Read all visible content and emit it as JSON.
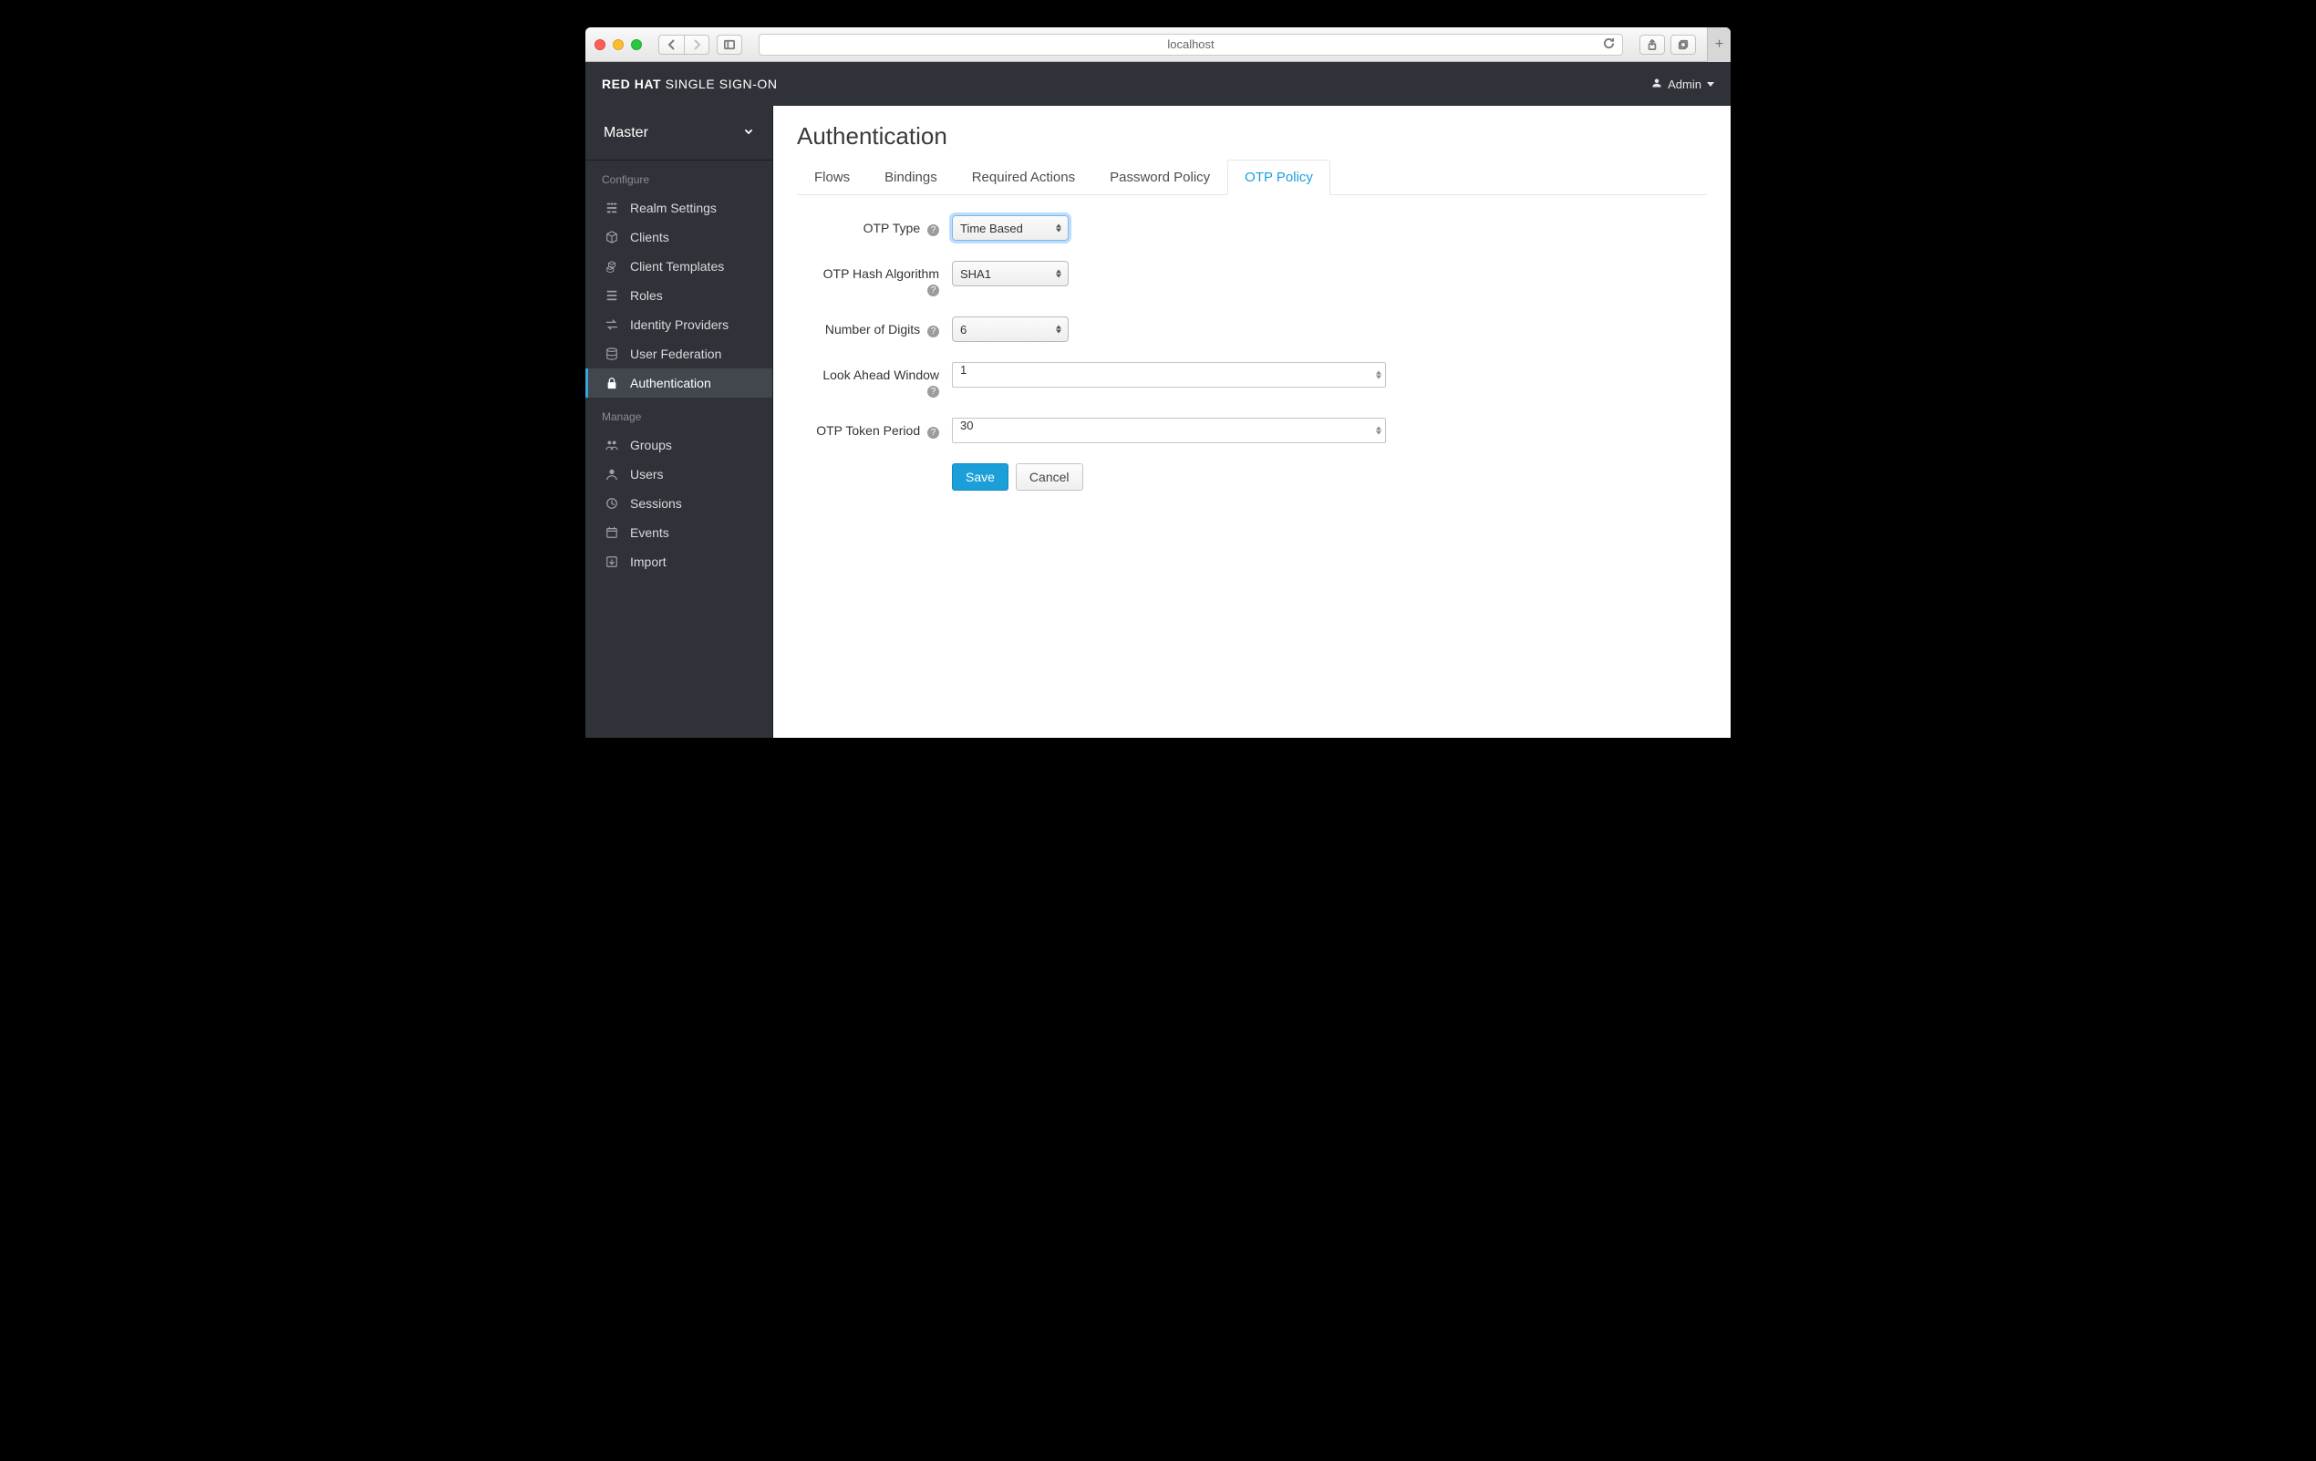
{
  "browser": {
    "url": "localhost"
  },
  "header": {
    "brand_bold": "RED HAT",
    "brand_light": "SINGLE SIGN-ON",
    "user_label": "Admin"
  },
  "realm": {
    "name": "Master"
  },
  "sidebar": {
    "section_configure": "Configure",
    "section_manage": "Manage",
    "configure_items": [
      {
        "label": "Realm Settings",
        "icon": "sliders"
      },
      {
        "label": "Clients",
        "icon": "cube"
      },
      {
        "label": "Client Templates",
        "icon": "cubes"
      },
      {
        "label": "Roles",
        "icon": "list"
      },
      {
        "label": "Identity Providers",
        "icon": "exchange"
      },
      {
        "label": "User Federation",
        "icon": "database"
      },
      {
        "label": "Authentication",
        "icon": "lock"
      }
    ],
    "manage_items": [
      {
        "label": "Groups",
        "icon": "users"
      },
      {
        "label": "Users",
        "icon": "user"
      },
      {
        "label": "Sessions",
        "icon": "clock"
      },
      {
        "label": "Events",
        "icon": "calendar"
      },
      {
        "label": "Import",
        "icon": "import"
      }
    ]
  },
  "page": {
    "title": "Authentication"
  },
  "tabs": [
    {
      "label": "Flows"
    },
    {
      "label": "Bindings"
    },
    {
      "label": "Required Actions"
    },
    {
      "label": "Password Policy"
    },
    {
      "label": "OTP Policy"
    }
  ],
  "form": {
    "otp_type": {
      "label": "OTP Type",
      "value": "Time Based"
    },
    "hash_alg": {
      "label": "OTP Hash Algorithm",
      "value": "SHA1"
    },
    "num_digits": {
      "label": "Number of Digits",
      "value": "6"
    },
    "look_ahead": {
      "label": "Look Ahead Window",
      "value": "1"
    },
    "token_period": {
      "label": "OTP Token Period",
      "value": "30"
    },
    "save_label": "Save",
    "cancel_label": "Cancel"
  }
}
